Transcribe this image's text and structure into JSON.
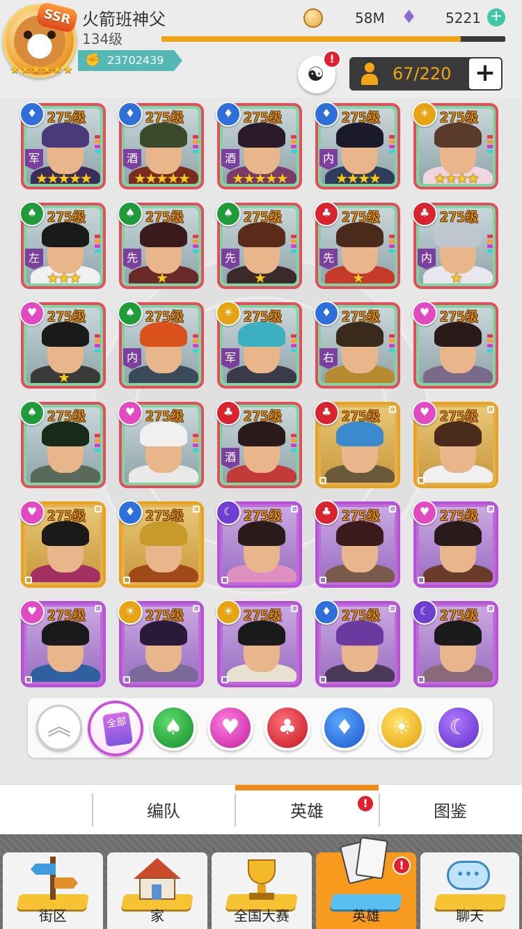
{
  "player": {
    "name": "火箭班神父",
    "level": "134级",
    "id": "23702439",
    "vip_badge": "SSR",
    "exp_percent": 87
  },
  "currency": {
    "gold": "58M",
    "gems": "5221"
  },
  "hero_count": "67/220",
  "icons": {
    "settings": "mask-icon",
    "gold": "coin-icon",
    "gem": "gem-icon",
    "id": "fist-icon"
  },
  "heroes": [
    {
      "level": "275级",
      "suit": "diamond",
      "role": "军",
      "stars": "★★★★★",
      "frame": "red"
    },
    {
      "level": "275级",
      "suit": "diamond",
      "role": "酒",
      "stars": "★★★★★",
      "frame": "red"
    },
    {
      "level": "275级",
      "suit": "diamond",
      "role": "酒",
      "stars": "★★★★★",
      "frame": "red"
    },
    {
      "level": "275级",
      "suit": "diamond",
      "role": "内",
      "stars": "★★★★",
      "frame": "red"
    },
    {
      "level": "275级",
      "suit": "sun",
      "role": "",
      "stars": "★★★★",
      "frame": "red"
    },
    {
      "level": "275级",
      "suit": "spade",
      "role": "左",
      "stars": "★★★",
      "frame": "red"
    },
    {
      "level": "275级",
      "suit": "spade",
      "role": "先",
      "stars": "★",
      "frame": "red"
    },
    {
      "level": "275级",
      "suit": "spade",
      "role": "先",
      "stars": "★",
      "frame": "red"
    },
    {
      "level": "275级",
      "suit": "club",
      "role": "先",
      "stars": "★",
      "frame": "red"
    },
    {
      "level": "275级",
      "suit": "club",
      "role": "内",
      "stars": "★",
      "frame": "red"
    },
    {
      "level": "275级",
      "suit": "heart",
      "role": "",
      "stars": "★",
      "frame": "red"
    },
    {
      "level": "275级",
      "suit": "spade",
      "role": "内",
      "stars": "",
      "frame": "red"
    },
    {
      "level": "275级",
      "suit": "sun",
      "role": "军",
      "stars": "",
      "frame": "red"
    },
    {
      "level": "275级",
      "suit": "diamond",
      "role": "右",
      "stars": "",
      "frame": "red"
    },
    {
      "level": "275级",
      "suit": "heart",
      "role": "",
      "stars": "",
      "frame": "red"
    },
    {
      "level": "275级",
      "suit": "spade",
      "role": "",
      "stars": "",
      "frame": "red"
    },
    {
      "level": "275级",
      "suit": "heart",
      "role": "",
      "stars": "",
      "frame": "red"
    },
    {
      "level": "275级",
      "suit": "club",
      "role": "酒",
      "stars": "",
      "frame": "red"
    },
    {
      "level": "275级",
      "suit": "club",
      "role": "",
      "stars": "",
      "frame": "gold"
    },
    {
      "level": "275级",
      "suit": "heart",
      "role": "",
      "stars": "",
      "frame": "gold"
    },
    {
      "level": "275级",
      "suit": "heart",
      "role": "",
      "stars": "",
      "frame": "gold"
    },
    {
      "level": "275级",
      "suit": "diamond",
      "role": "",
      "stars": "",
      "frame": "gold"
    },
    {
      "level": "275级",
      "suit": "moon",
      "role": "",
      "stars": "",
      "frame": "purple"
    },
    {
      "level": "275级",
      "suit": "club",
      "role": "",
      "stars": "",
      "frame": "purple"
    },
    {
      "level": "275级",
      "suit": "heart",
      "role": "",
      "stars": "",
      "frame": "purple"
    },
    {
      "level": "275级",
      "suit": "heart",
      "role": "",
      "stars": "",
      "frame": "purple"
    },
    {
      "level": "275级",
      "suit": "sun",
      "role": "",
      "stars": "",
      "frame": "purple"
    },
    {
      "level": "275级",
      "suit": "sun",
      "role": "",
      "stars": "",
      "frame": "purple"
    },
    {
      "level": "275级",
      "suit": "diamond",
      "role": "",
      "stars": "",
      "frame": "purple"
    },
    {
      "level": "275级",
      "suit": "moon",
      "role": "",
      "stars": "",
      "frame": "purple"
    }
  ],
  "filters": {
    "collapse_icon": "chevron-up-icon",
    "all_label": "全部",
    "suits": [
      "spade",
      "heart",
      "club",
      "diamond",
      "sun",
      "moon"
    ]
  },
  "tabs": [
    {
      "label": "编队"
    },
    {
      "label": "英雄"
    },
    {
      "label": "图鉴"
    }
  ],
  "nav": [
    {
      "label": "街区",
      "icon": "signpost-icon"
    },
    {
      "label": "家",
      "icon": "house-icon"
    },
    {
      "label": "全国大赛",
      "icon": "trophy-icon"
    },
    {
      "label": "英雄",
      "icon": "hero-cards-icon"
    },
    {
      "label": "聊天",
      "icon": "chat-bubble-icon"
    }
  ],
  "colors": {
    "accent": "#f28a17",
    "frame_red": "#e24e5a",
    "frame_gold": "#e9a21c",
    "frame_purple": "#b553d6"
  }
}
